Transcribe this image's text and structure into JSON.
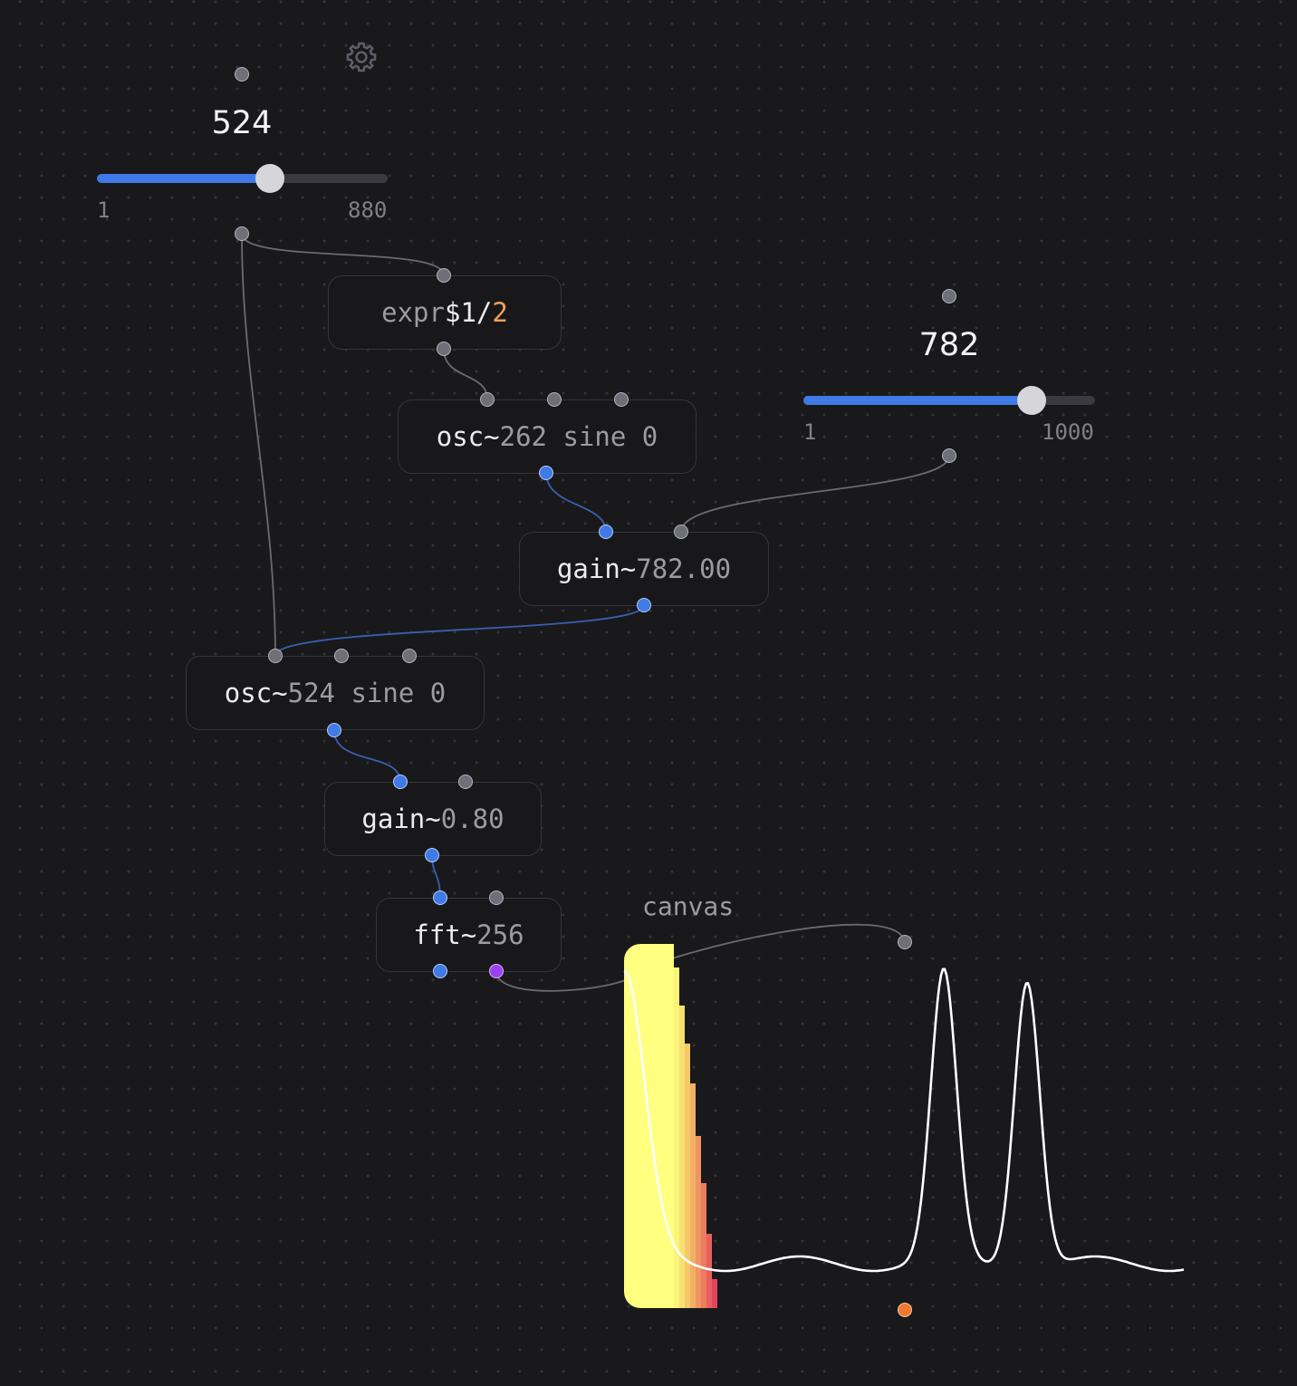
{
  "sliders": [
    {
      "value": "524",
      "min": "1",
      "max": "880",
      "fraction": 0.595
    },
    {
      "value": "782",
      "min": "1",
      "max": "1000",
      "fraction": 0.782
    }
  ],
  "nodes": {
    "expr": {
      "name": "expr",
      "arg1": "$1",
      "op": "/",
      "arg2": "2"
    },
    "osc_top": {
      "name": "osc~",
      "args": "262 sine 0"
    },
    "gain_top": {
      "name": "gain~",
      "args": "782.00"
    },
    "osc_bottom": {
      "name": "osc~",
      "args": "524 sine 0"
    },
    "gain_bottom": {
      "name": "gain~",
      "args": "0.80"
    },
    "fft": {
      "name": "fft~",
      "args": "256"
    }
  },
  "canvas": {
    "label": "canvas"
  },
  "icons": {
    "settings": "gear-icon"
  },
  "colors": {
    "signal": "#3f7ae6",
    "message": "#6f6f78",
    "accent": "#f0a060"
  }
}
